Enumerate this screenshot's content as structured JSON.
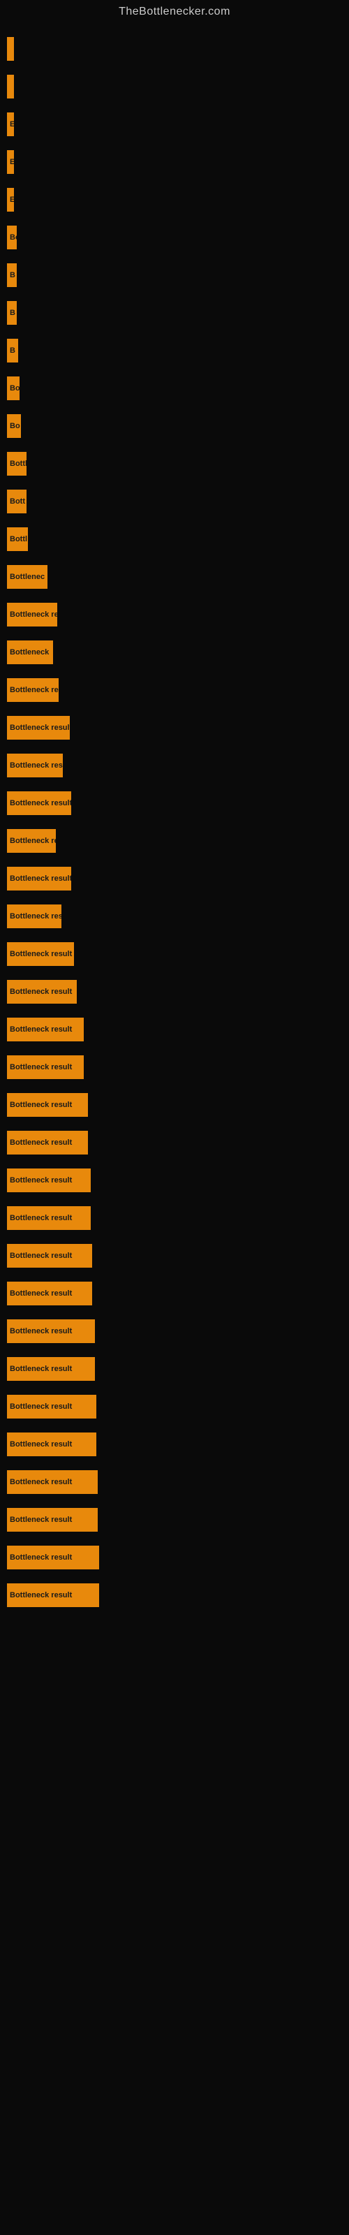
{
  "site": {
    "title": "TheBottlenecker.com"
  },
  "bars": [
    {
      "id": 1,
      "width": 4,
      "label": ""
    },
    {
      "id": 2,
      "width": 4,
      "label": ""
    },
    {
      "id": 3,
      "width": 8,
      "label": "E"
    },
    {
      "id": 4,
      "width": 8,
      "label": "E"
    },
    {
      "id": 5,
      "width": 8,
      "label": "E"
    },
    {
      "id": 6,
      "width": 14,
      "label": "Bo"
    },
    {
      "id": 7,
      "width": 14,
      "label": "B"
    },
    {
      "id": 8,
      "width": 14,
      "label": "B"
    },
    {
      "id": 9,
      "width": 16,
      "label": "B"
    },
    {
      "id": 10,
      "width": 18,
      "label": "Bo"
    },
    {
      "id": 11,
      "width": 20,
      "label": "Bo"
    },
    {
      "id": 12,
      "width": 28,
      "label": "Bottl"
    },
    {
      "id": 13,
      "width": 28,
      "label": "Bott"
    },
    {
      "id": 14,
      "width": 30,
      "label": "Bottl"
    },
    {
      "id": 15,
      "width": 58,
      "label": "Bottlenec"
    },
    {
      "id": 16,
      "width": 72,
      "label": "Bottleneck res"
    },
    {
      "id": 17,
      "width": 66,
      "label": "Bottleneck"
    },
    {
      "id": 18,
      "width": 74,
      "label": "Bottleneck resu"
    },
    {
      "id": 19,
      "width": 90,
      "label": "Bottleneck result"
    },
    {
      "id": 20,
      "width": 80,
      "label": "Bottleneck resu"
    },
    {
      "id": 21,
      "width": 92,
      "label": "Bottleneck result"
    },
    {
      "id": 22,
      "width": 70,
      "label": "Bottleneck re"
    },
    {
      "id": 23,
      "width": 92,
      "label": "Bottleneck result"
    },
    {
      "id": 24,
      "width": 78,
      "label": "Bottleneck resu"
    },
    {
      "id": 25,
      "width": 96,
      "label": "Bottleneck result"
    },
    {
      "id": 26,
      "width": 100,
      "label": "Bottleneck result"
    },
    {
      "id": 27,
      "width": 110,
      "label": "Bottleneck result"
    },
    {
      "id": 28,
      "width": 110,
      "label": "Bottleneck result"
    },
    {
      "id": 29,
      "width": 116,
      "label": "Bottleneck result"
    },
    {
      "id": 30,
      "width": 116,
      "label": "Bottleneck result"
    },
    {
      "id": 31,
      "width": 120,
      "label": "Bottleneck result"
    },
    {
      "id": 32,
      "width": 120,
      "label": "Bottleneck result"
    },
    {
      "id": 33,
      "width": 122,
      "label": "Bottleneck result"
    },
    {
      "id": 34,
      "width": 122,
      "label": "Bottleneck result"
    },
    {
      "id": 35,
      "width": 126,
      "label": "Bottleneck result"
    },
    {
      "id": 36,
      "width": 126,
      "label": "Bottleneck result"
    },
    {
      "id": 37,
      "width": 128,
      "label": "Bottleneck result"
    },
    {
      "id": 38,
      "width": 128,
      "label": "Bottleneck result"
    },
    {
      "id": 39,
      "width": 130,
      "label": "Bottleneck result"
    },
    {
      "id": 40,
      "width": 130,
      "label": "Bottleneck result"
    },
    {
      "id": 41,
      "width": 132,
      "label": "Bottleneck result"
    },
    {
      "id": 42,
      "width": 132,
      "label": "Bottleneck result"
    }
  ]
}
